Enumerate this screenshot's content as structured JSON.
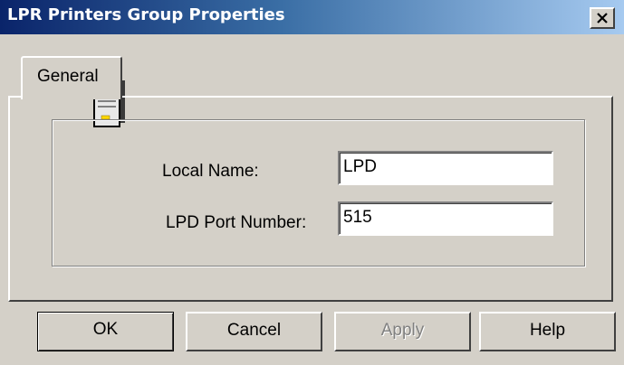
{
  "window": {
    "title": "LPR Printers Group Properties",
    "close_glyph": "close-icon"
  },
  "tabs": [
    {
      "label": "General",
      "selected": true
    }
  ],
  "form": {
    "icon": "server-icon",
    "local_name": {
      "label": "Local Name:",
      "value": "LPD"
    },
    "port_number": {
      "label": "LPD Port Number:",
      "value": "515"
    }
  },
  "buttons": {
    "ok": "OK",
    "cancel": "Cancel",
    "apply": "Apply",
    "help": "Help"
  },
  "colors": {
    "title_gradient_start": "#0a246a",
    "title_gradient_end": "#a6caf0",
    "face": "#d4d0c8"
  }
}
